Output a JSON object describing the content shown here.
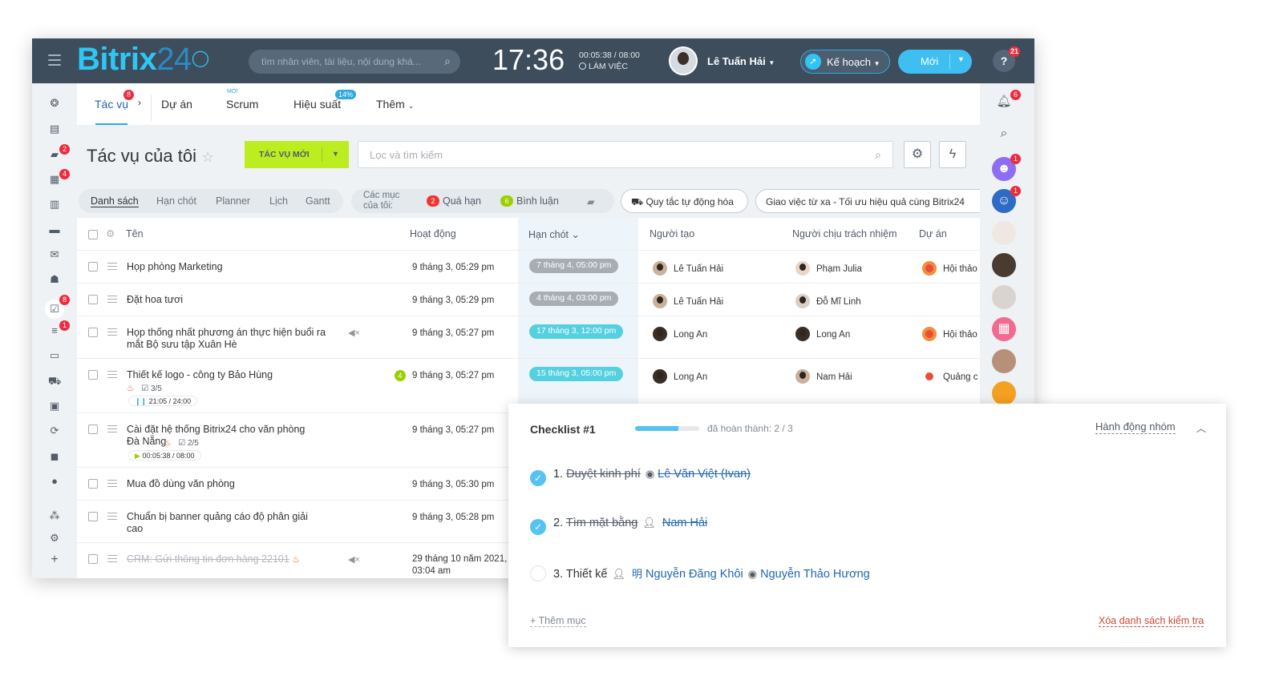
{
  "topbar": {
    "logo_main": "Bitrix",
    "logo_num": "24",
    "search_placeholder": "tìm nhân viên, tài liệu, nội dung khá...",
    "time": "17:36",
    "work_time": "00:05:38 / 08:00",
    "work_status": "LÀM VIỆC",
    "user_name": "Lê Tuấn Hải",
    "plan_label": "Kế hoạch",
    "new_label": "Mới",
    "help_badge": "21"
  },
  "leftbar": {
    "badges": {
      "chat": "2",
      "calendar": "4",
      "tasks": "8",
      "filter": "1"
    }
  },
  "tabs": {
    "tasks": "Tác vụ",
    "tasks_badge": "8",
    "projects": "Dự án",
    "scrum": "Scrum",
    "scrum_new": "MỚI",
    "efficiency": "Hiệu suất",
    "efficiency_pct": "14%",
    "more": "Thêm"
  },
  "toolbar": {
    "page_title": "Tác vụ của tôi",
    "new_task": "TÁC VỤ MỚI",
    "filter_placeholder": "Lọc và tìm kiếm"
  },
  "views": [
    "Danh sách",
    "Hạn chót",
    "Planner",
    "Lịch",
    "Gantt"
  ],
  "counters": {
    "label": "Các mục của tôi:",
    "overdue_count": "2",
    "overdue_label": "Quá hạn",
    "comments_count": "6",
    "comments_label": "Bình luận",
    "overdue_color": "#f0372f",
    "comments_color": "#9dcf00"
  },
  "pills": {
    "automation": "Quy tắc tự động hóa",
    "remote": "Giao việc từ xa - Tối ưu hiệu quả cùng Bitrix24"
  },
  "columns": {
    "name": "Tên",
    "activity": "Hoạt động",
    "deadline": "Hạn chót",
    "creator": "Người tạo",
    "responsible": "Người chịu trách nhiệm",
    "project": "Dự án"
  },
  "rows": [
    {
      "name": "Họp phòng Marketing",
      "activity": "9 tháng 3, 05:29 pm",
      "deadline": "7 tháng 4, 05:00 pm",
      "creator": "Lê Tuấn Hải",
      "responsible": "Phạm Julia",
      "project": "Hội thảo"
    },
    {
      "name": "Đặt hoa tươi",
      "activity": "9 tháng 3, 05:29 pm",
      "deadline": "4 tháng 4, 03:00 pm",
      "creator": "Lê Tuấn Hải",
      "responsible": "Đỗ Mĩ Linh",
      "project": ""
    },
    {
      "name": "Họp thống nhất phương án thực hiện buổi ra mắt Bộ sưu tập Xuân Hè",
      "activity": "9 tháng 3, 05:27 pm",
      "deadline": "17 tháng 3, 12:00 pm",
      "creator": "Long An",
      "responsible": "Long An",
      "project": "Hội thảo"
    },
    {
      "name": "Thiết kế logo - công ty Bảo Hùng",
      "activity": "9 tháng 3, 05:27 pm",
      "deadline": "15 tháng 3, 05:00 pm",
      "creator": "Long An",
      "responsible": "Nam Hải",
      "project": "Quảng c",
      "comments": "4",
      "checklist": "3/5",
      "timer": "21:05 / 24:00"
    },
    {
      "name": "Cài đặt hệ thống Bitrix24 cho văn phòng Đà Nẵng",
      "activity": "9 tháng 3, 05:27 pm",
      "checklist": "2/5",
      "timer": "00:05:38 / 08:00"
    },
    {
      "name": "Mua đồ dùng văn phòng",
      "activity": "9 tháng 3, 05:30 pm"
    },
    {
      "name": "Chuẩn bị banner quảng cáo độ phân giải cao",
      "activity": "9 tháng 3, 05:28 pm"
    },
    {
      "name": "CRM: Gửi thông tin đơn hàng 22101",
      "activity": "29 tháng 10 năm 2021, 03:04 am"
    }
  ],
  "rightbar": {
    "bell_badge": "6",
    "badge1": "1",
    "badge2": "1"
  },
  "checklist": {
    "title": "Checklist #1",
    "progress": 0.67,
    "done_text": "đã hoàn thành: 2 / 3",
    "group_action": "Hành động nhóm",
    "items": [
      {
        "num": "1.",
        "text": "Duyệt kinh phí",
        "done": true,
        "people": [
          "Lê Văn Việt (Ivan)"
        ]
      },
      {
        "num": "2.",
        "text": "Tìm mặt bằng",
        "done": true,
        "people": [
          "Nam Hải"
        ]
      },
      {
        "num": "3.",
        "text": "Thiết kế",
        "done": false,
        "people": [
          "Nguyễn Đăng Khôi",
          "Nguyễn Thảo Hương"
        ]
      }
    ],
    "add_item": "+ Thêm mục",
    "delete_list": "Xóa danh sách kiểm tra"
  }
}
